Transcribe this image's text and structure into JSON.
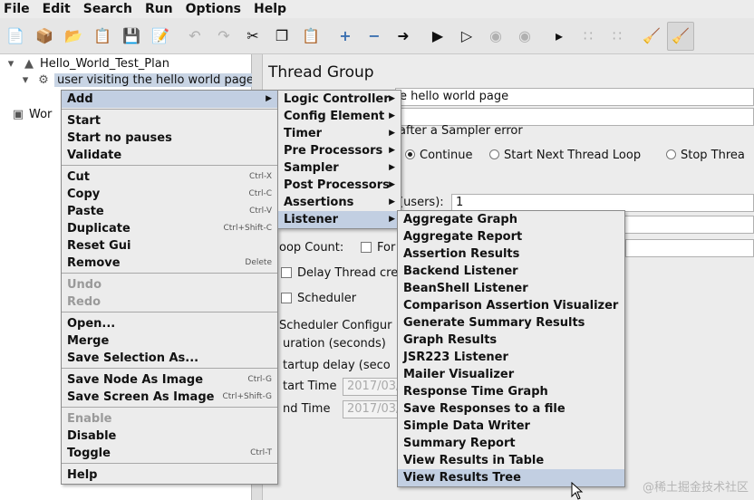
{
  "menubar": [
    "File",
    "Edit",
    "Search",
    "Run",
    "Options",
    "Help"
  ],
  "toolbar_icons": [
    "new-icon",
    "templates-icon",
    "open-icon",
    "open-recent-icon",
    "save-icon",
    "save-as-icon",
    "undo-icon",
    "redo-icon",
    "cut-icon",
    "copy-icon",
    "paste-icon",
    "expand-icon",
    "collapse-icon",
    "toggle-icon",
    "start-icon",
    "start-no-pauses-icon",
    "stop-icon",
    "shutdown-icon",
    "remote-start-icon",
    "remote-stop-icon",
    "remote-shutdown-icon",
    "clear-icon",
    "clear-all-icon"
  ],
  "tree": {
    "plan": "Hello_World_Test_Plan",
    "thread_group": "user visiting the hello world page",
    "workbench": "Wor"
  },
  "panel": {
    "title": "Thread Group",
    "name_value": "e hello world page",
    "error_label": "after a Sampler error",
    "continue": "Continue",
    "start_next": "Start Next Thread Loop",
    "stop_thread": "Stop Threa",
    "users_label": "(users):",
    "users_value": "1",
    "loop_label": "oop Count:",
    "forever": "For",
    "delay_label": "Delay Thread cre",
    "scheduler": "Scheduler",
    "scheduler_config": "Scheduler Configur",
    "duration": "uration (seconds)",
    "startup_delay": "tartup delay (seco",
    "start_time": "tart Time",
    "start_time_value": "2017/03/",
    "end_time": "nd Time",
    "end_time_value": "2017/03/"
  },
  "context_menu": [
    {
      "label": "Add",
      "submenu": true,
      "hi": true
    },
    {
      "sep": true
    },
    {
      "label": "Start"
    },
    {
      "label": "Start no pauses"
    },
    {
      "label": "Validate"
    },
    {
      "sep": true
    },
    {
      "label": "Cut",
      "shortcut": "Ctrl-X"
    },
    {
      "label": "Copy",
      "shortcut": "Ctrl-C"
    },
    {
      "label": "Paste",
      "shortcut": "Ctrl-V"
    },
    {
      "label": "Duplicate",
      "shortcut": "Ctrl+Shift-C"
    },
    {
      "label": "Reset Gui"
    },
    {
      "label": "Remove",
      "shortcut": "Delete"
    },
    {
      "sep": true
    },
    {
      "label": "Undo",
      "dim": true
    },
    {
      "label": "Redo",
      "dim": true
    },
    {
      "sep": true
    },
    {
      "label": "Open..."
    },
    {
      "label": "Merge"
    },
    {
      "label": "Save Selection As..."
    },
    {
      "sep": true
    },
    {
      "label": "Save Node As Image",
      "shortcut": "Ctrl-G"
    },
    {
      "label": "Save Screen As Image",
      "shortcut": "Ctrl+Shift-G"
    },
    {
      "sep": true
    },
    {
      "label": "Enable",
      "dim": true
    },
    {
      "label": "Disable"
    },
    {
      "label": "Toggle",
      "shortcut": "Ctrl-T"
    },
    {
      "sep": true
    },
    {
      "label": "Help"
    }
  ],
  "add_menu": [
    {
      "label": "Logic Controller",
      "submenu": true
    },
    {
      "label": "Config Element",
      "submenu": true
    },
    {
      "label": "Timer",
      "submenu": true
    },
    {
      "label": "Pre Processors",
      "submenu": true
    },
    {
      "label": "Sampler",
      "submenu": true
    },
    {
      "label": "Post Processors",
      "submenu": true
    },
    {
      "label": "Assertions",
      "submenu": true
    },
    {
      "label": "Listener",
      "submenu": true,
      "hi": true
    }
  ],
  "listener_menu": [
    {
      "label": "Aggregate Graph"
    },
    {
      "label": "Aggregate Report"
    },
    {
      "label": "Assertion Results"
    },
    {
      "label": "Backend Listener"
    },
    {
      "label": "BeanShell Listener"
    },
    {
      "label": "Comparison Assertion Visualizer"
    },
    {
      "label": "Generate Summary Results"
    },
    {
      "label": "Graph Results"
    },
    {
      "label": "JSR223 Listener"
    },
    {
      "label": "Mailer Visualizer"
    },
    {
      "label": "Response Time Graph"
    },
    {
      "label": "Save Responses to a file"
    },
    {
      "label": "Simple Data Writer"
    },
    {
      "label": "Summary Report"
    },
    {
      "label": "View Results in Table"
    },
    {
      "label": "View Results Tree",
      "hi": true
    }
  ],
  "watermark": "@稀土掘金技术社区"
}
